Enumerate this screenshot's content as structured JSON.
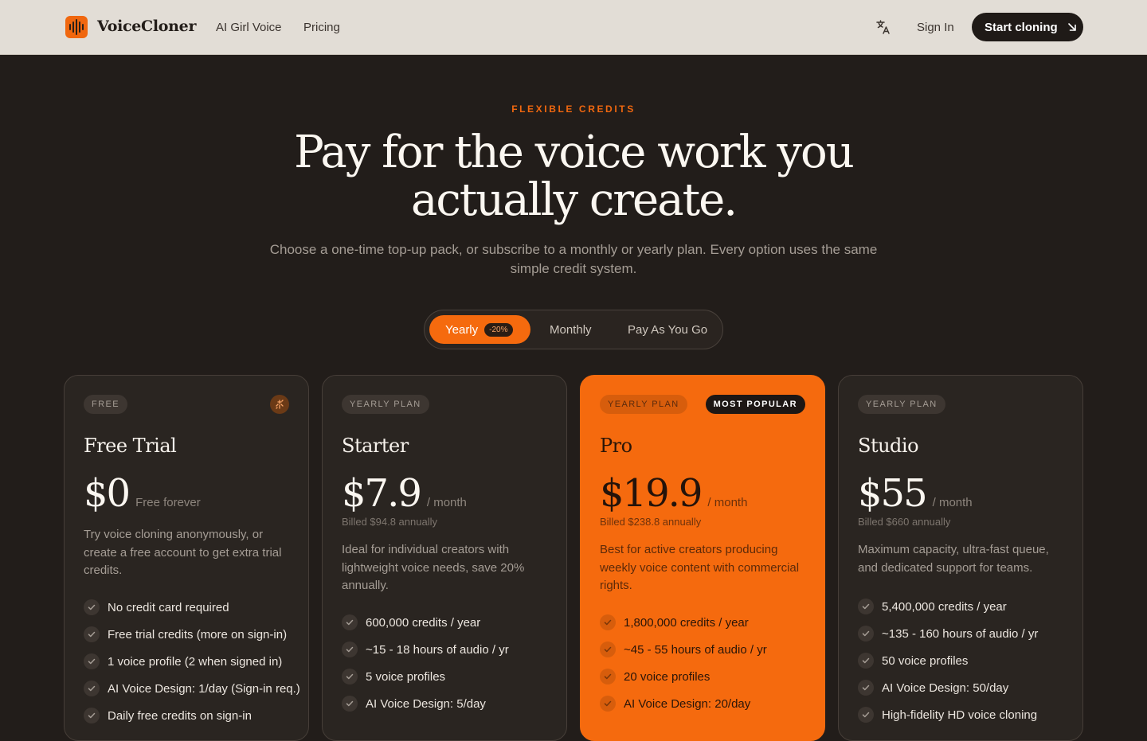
{
  "header": {
    "brand": "VoiceCloner",
    "nav": [
      "AI Girl Voice",
      "Pricing"
    ],
    "language_icon": "translate-icon",
    "sign_in": "Sign In",
    "cta": "Start cloning",
    "cta_icon": "arrow-down-right-icon"
  },
  "hero": {
    "eyebrow": "FLEXIBLE CREDITS",
    "headline_line1": "Pay for the voice work you",
    "headline_line2": "actually create.",
    "subtitle": "Choose a one-time top-up pack, or subscribe to a monthly or yearly plan. Every option uses the same simple credit system."
  },
  "billing_toggle": {
    "options": [
      "Yearly",
      "Monthly",
      "Pay As You Go"
    ],
    "selected": "Yearly",
    "discount_badge": "-20%"
  },
  "colors": {
    "accent": "#f56a0e",
    "background": "#221d1a",
    "header_bg": "#e2ddd6",
    "card_bg": "#2a2521"
  },
  "plans": [
    {
      "tag": "FREE",
      "name": "Free Trial",
      "price": "$0",
      "period": "Free forever",
      "billed": "",
      "description": "Try voice cloning anonymously, or create a free account to get extra trial credits.",
      "features": [
        "No credit card required",
        "Free trial credits (more on sign-in)",
        "1 voice profile (2 when signed in)",
        "AI Voice Design: 1/day (Sign-in req.)",
        "Daily free credits on sign-in"
      ]
    },
    {
      "tag": "YEARLY PLAN",
      "name": "Starter",
      "price": "$7.9",
      "period": "/ month",
      "billed": "Billed $94.8 annually",
      "description": "Ideal for individual creators with lightweight voice needs, save 20% annually.",
      "features": [
        "600,000 credits / year",
        "~15 - 18 hours of audio / yr",
        "5 voice profiles",
        "AI Voice Design: 5/day"
      ]
    },
    {
      "tag": "YEARLY PLAN",
      "badge": "MOST POPULAR",
      "name": "Pro",
      "price": "$19.9",
      "period": "/ month",
      "billed": "Billed $238.8 annually",
      "description": "Best for active creators producing weekly voice content with commercial rights.",
      "features": [
        "1,800,000 credits / year",
        "~45 - 55 hours of audio / yr",
        "20 voice profiles",
        "AI Voice Design: 20/day"
      ]
    },
    {
      "tag": "YEARLY PLAN",
      "name": "Studio",
      "price": "$55",
      "period": "/ month",
      "billed": "Billed $660 annually",
      "description": "Maximum capacity, ultra-fast queue, and dedicated support for teams.",
      "features": [
        "5,400,000 credits / year",
        "~135 - 160 hours of audio / yr",
        "50 voice profiles",
        "AI Voice Design: 50/day",
        "High-fidelity HD voice cloning"
      ]
    }
  ]
}
